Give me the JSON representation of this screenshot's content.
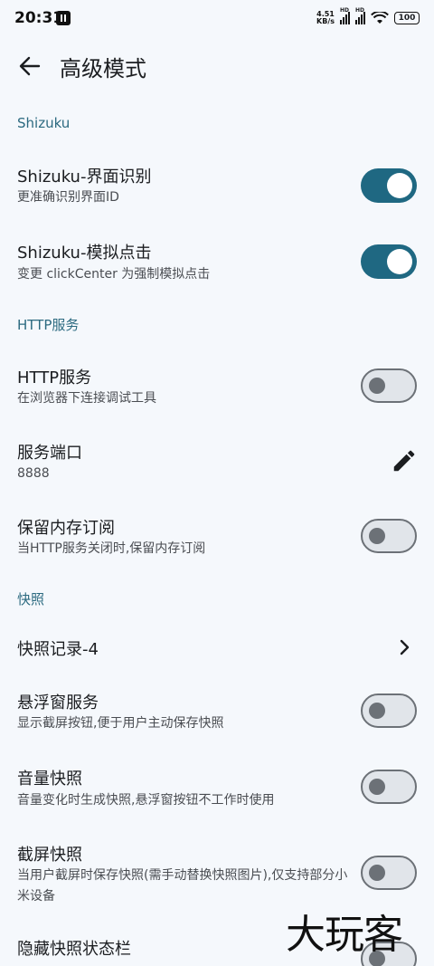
{
  "status_bar": {
    "time": "20:31",
    "net_speed_value": "4.51",
    "net_speed_unit": "KB/s",
    "sim1_label": "HD",
    "sim2_label": "HD",
    "battery": "100"
  },
  "header": {
    "title": "高级模式"
  },
  "sections": {
    "shizuku": "Shizuku",
    "http": "HTTP服务",
    "snapshot": "快照"
  },
  "items": {
    "shizuku_ui": {
      "title": "Shizuku-界面识别",
      "subtitle": "更准确识别界面ID",
      "enabled": true
    },
    "shizuku_click": {
      "title": "Shizuku-模拟点击",
      "subtitle": "变更 clickCenter 为强制模拟点击",
      "enabled": true
    },
    "http_service": {
      "title": "HTTP服务",
      "subtitle": "在浏览器下连接调试工具",
      "enabled": false
    },
    "service_port": {
      "title": "服务端口",
      "value": "8888"
    },
    "keep_memory": {
      "title": "保留内存订阅",
      "subtitle": "当HTTP服务关闭时,保留内存订阅",
      "enabled": false
    },
    "snapshot_records": {
      "title": "快照记录-4"
    },
    "float_window": {
      "title": "悬浮窗服务",
      "subtitle": "显示截屏按钮,便于用户主动保存快照",
      "enabled": false
    },
    "volume_snapshot": {
      "title": "音量快照",
      "subtitle": "音量变化时生成快照,悬浮窗按钮不工作时使用",
      "enabled": false
    },
    "screenshot_snapshot": {
      "title": "截屏快照",
      "subtitle": "当用户截屏时保存快照(需手动替换快照图片),仅支持部分小米设备",
      "enabled": false
    },
    "hide_snapshot_status": {
      "title": "隐藏快照状态栏",
      "enabled": false
    }
  },
  "watermark": "大玩客",
  "icons": {
    "back": "arrow-left-icon",
    "edit": "pencil-icon",
    "chevron": "chevron-right-icon"
  },
  "colors": {
    "accent": "#1f6882",
    "section": "#2c6a80",
    "background": "#f5f8fc"
  }
}
